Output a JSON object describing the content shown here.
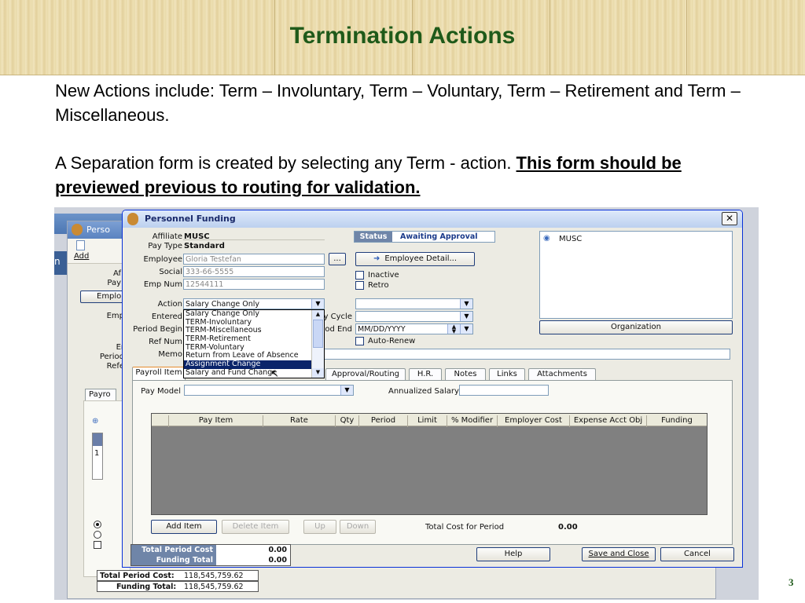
{
  "slide": {
    "title": "Termination Actions",
    "para1": "New Actions include: Term – Involuntary, Term – Voluntary, Term – Retirement and Term – Miscellaneous.",
    "para2_plain": "A Separation form is created by selecting any Term - action. ",
    "para2_emph": "This form should be previewed previous to routing for validation.",
    "page_number": "3"
  },
  "bg_window": {
    "title": "Perso",
    "add_label": "Add",
    "left_labels": [
      "Af",
      "Pay",
      "Emplo",
      "Emp",
      "",
      "Er",
      "Period",
      "Refe"
    ],
    "tab_label": "Payro",
    "row_number": "1",
    "totals": [
      {
        "label": "Total Period Cost:",
        "value": "118,545,759.62"
      },
      {
        "label": "Funding Total:",
        "value": "118,545,759.62"
      }
    ]
  },
  "dialog": {
    "title": "Personnel Funding",
    "fields": {
      "affiliate": {
        "label": "Affiliate",
        "value": "MUSC"
      },
      "pay_type": {
        "label": "Pay Type",
        "value": "Standard"
      },
      "employee": {
        "label": "Employee",
        "value": "Gloria Testefan"
      },
      "social": {
        "label": "Social",
        "value": "333-66-5555"
      },
      "emp_num": {
        "label": "Emp Num",
        "value": "12544111"
      },
      "action": {
        "label": "Action",
        "value": "Salary Change Only"
      },
      "entered": {
        "label": "Entered"
      },
      "period_begin": {
        "label": "Period Begin"
      },
      "ref_num": {
        "label": "Ref Num"
      },
      "memo": {
        "label": "Memo"
      },
      "cycle_label": "y Cycle",
      "period_end": {
        "label": "od End",
        "value": "MM/DD/YYYY"
      }
    },
    "ellipsis_label": "...",
    "status": {
      "label": "Status",
      "value": "Awaiting Approval"
    },
    "employee_detail_button": "Employee Detail...",
    "inactive_label": "Inactive",
    "retro_label": "Retro",
    "auto_renew_label": "Auto-Renew",
    "org_tree_item": "MUSC",
    "organization_button": "Organization",
    "action_options": [
      "Salary Change Only",
      "TERM-Involuntary",
      "TERM-Miscellaneous",
      "TERM-Retirement",
      "TERM-Voluntary",
      "Return from Leave of Absence",
      "Assignment Change",
      "Salary and Fund Change"
    ],
    "selected_option": "Assignment Change",
    "tabs": [
      "Payroll Item",
      "Approval/Routing",
      "H.R.",
      "Notes",
      "Links",
      "Attachments"
    ],
    "pay_model_label": "Pay Model",
    "annualized_salary_label": "Annualized Salary",
    "grid_columns": [
      "Pay Item",
      "Rate",
      "Qty",
      "Period",
      "Limit",
      "% Modifier",
      "Employer Cost",
      "Expense Acct Obj",
      "Funding"
    ],
    "buttons": {
      "add_item": "Add Item",
      "delete_item": "Delete Item",
      "up": "Up",
      "down": "Down",
      "help": "Help",
      "save_close": "Save and Close",
      "cancel": "Cancel"
    },
    "total_cost_label": "Total Cost for Period",
    "total_cost_value": "0.00",
    "summary": [
      {
        "label": "Total Period Cost",
        "value": "0.00"
      },
      {
        "label": "Funding Total",
        "value": "0.00"
      }
    ],
    "close_symbol": "✕"
  },
  "colors": {
    "title_green": "#1f5a1a",
    "xp_blue": "#0a4fd8",
    "selection": "#0a246a"
  }
}
